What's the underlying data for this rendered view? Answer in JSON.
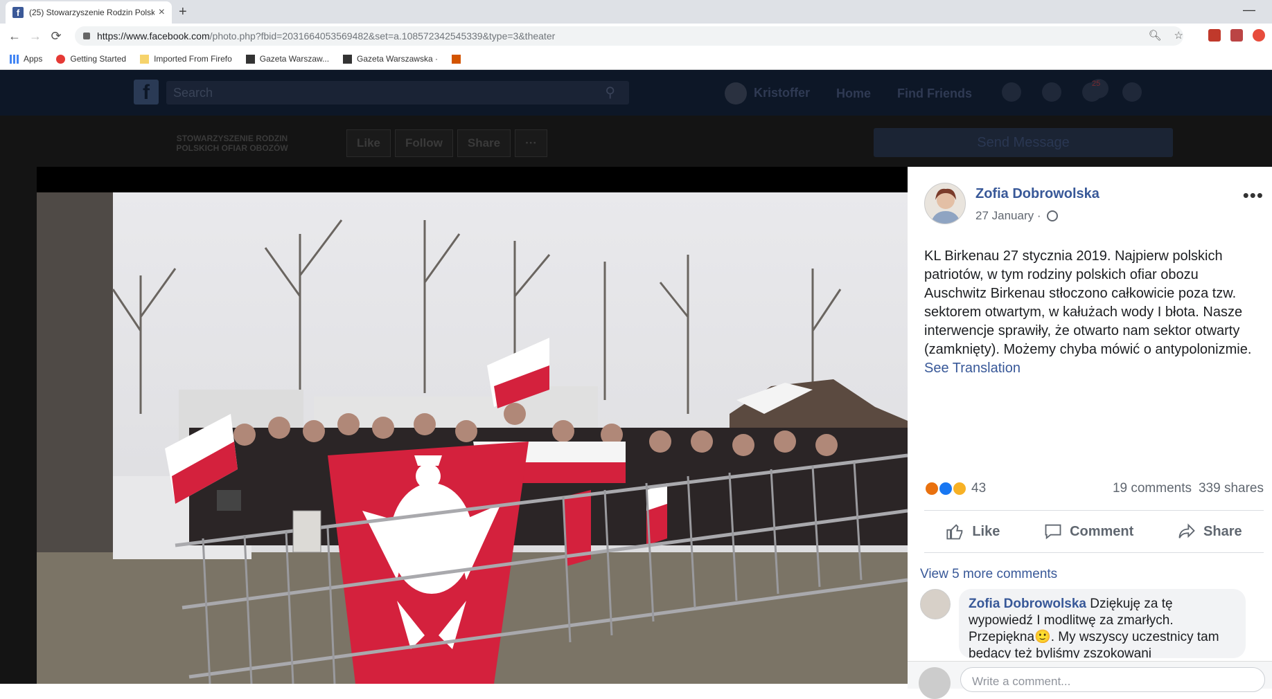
{
  "browser": {
    "tab_title": "(25) Stowarzyszenie Rodzin Polsk",
    "url_host": "https://www.facebook.com",
    "url_path": "/photo.php?fbid=2031664053569482&set=a.108572342545339&type=3&theater",
    "bookmarks": [
      "Apps",
      "Getting Started",
      "Imported From Firefo",
      "Gazeta Warszaw...",
      "Gazeta Warszawska ·"
    ]
  },
  "fb_header": {
    "search_placeholder": "Search",
    "user_name": "Kristoffer",
    "home": "Home",
    "find_friends": "Find Friends",
    "notif_count": "25"
  },
  "page": {
    "logo_text": "STOWARZYSZENIE RODZIN POLSKICH OFIAR OBOZÓW",
    "buttons": [
      "Like",
      "Follow",
      "Share",
      "···"
    ],
    "send_message": "Send Message"
  },
  "post": {
    "author": "Zofia Dobrowolska",
    "date": "27 January ·",
    "text": "KL Birkenau 27 stycznia 2019. Najpierw polskich patriotów, w tym rodziny polskich ofiar obozu Auschwitz Birkenau stłoczono całkowicie poza tzw. sektorem otwartym, w kałużach wody I błota. Nasze interwencje sprawiły, że otwarto nam sektor otwarty (zamknięty). Możemy chyba mówić o antypolonizmie.",
    "see_translation": "See Translation",
    "reactions_count": "43",
    "comments": "19 comments",
    "shares": "339 shares",
    "like": "Like",
    "comment": "Comment",
    "share": "Share",
    "view_more": "View 5 more comments",
    "comment_author": "Zofia Dobrowolska",
    "comment_text": "Dziękuję za tę wypowiedź I modlitwę za zmarłych. Przepiękna🙂. My wszyscy uczestnicy tam będący też byliśmy zszokowani",
    "write_placeholder": "Write a comment..."
  },
  "colors": {
    "fb_blue": "#385898",
    "flag_red": "#d4213d"
  }
}
